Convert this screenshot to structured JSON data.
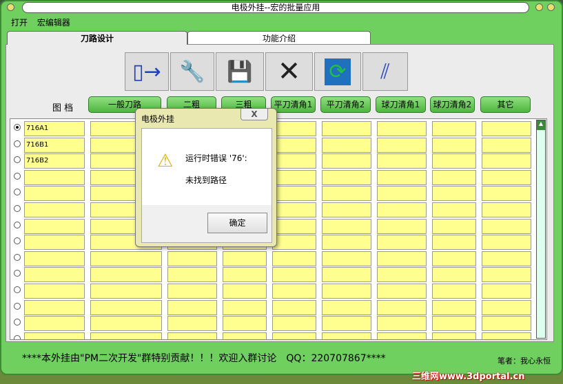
{
  "window": {
    "title": "电极外挂--宏的批量应用"
  },
  "menu": [
    "打开",
    "宏编辑器"
  ],
  "tabs": [
    {
      "label": "刀路设计",
      "active": true
    },
    {
      "label": "功能介绍",
      "active": false
    }
  ],
  "toolbar": [
    {
      "icon": "import-icon"
    },
    {
      "icon": "tool-settings-icon"
    },
    {
      "icon": "save-icon"
    },
    {
      "icon": "delete-icon"
    },
    {
      "icon": "refresh-icon"
    },
    {
      "icon": "tool-run-icon"
    }
  ],
  "filter_label": "图 档",
  "categories": [
    "一般刀路",
    "二粗",
    "三粗",
    "平刀清角1",
    "平刀清角2",
    "球刀清角1",
    "球刀清角2",
    "其它"
  ],
  "rows": [
    "716A1",
    "716B1",
    "716B2",
    "",
    "",
    "",
    "",
    "",
    "",
    "",
    "",
    "",
    "",
    ""
  ],
  "footer": "****本外挂由\"PM二次开发\"群特别贡献！！！欢迎入群讨论　QQ：220707867****",
  "author": "笔者：我心永恒",
  "watermark": "三维网www.3dportal.cn",
  "dialog": {
    "title": "电极外挂",
    "close": "X",
    "message1": "运行时错误 '76':",
    "message2": "未找到路径",
    "ok": "确定"
  }
}
